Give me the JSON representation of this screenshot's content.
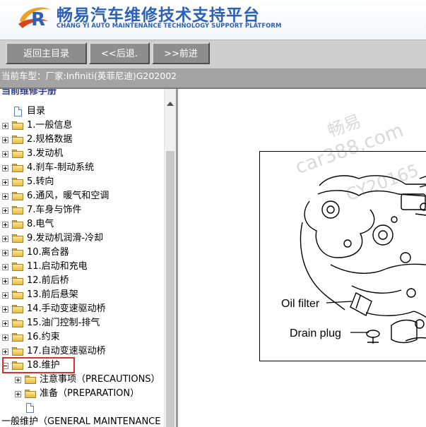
{
  "brand": {
    "title": "畅易汽车维修技术支持平台",
    "subtitle": "CHANG YI AUTO MAINTENANCE TECHNOLOGY SUPPORT PLATFORM",
    "logo_letter": "R"
  },
  "toolbar": {
    "home_label": "返回主目录",
    "back_label": "<<后退.",
    "forward_label": ">>前进"
  },
  "vehicle": {
    "text": "当前车型：厂家:Infiniti(英菲尼迪)G202002"
  },
  "tree": {
    "top_label": "当前维修手册",
    "root_doc_label": "目录",
    "folders": [
      {
        "label": "1.一般信息"
      },
      {
        "label": "2.规格数据"
      },
      {
        "label": "3.发动机"
      },
      {
        "label": "4.刹车-制动系统"
      },
      {
        "label": "5.转向"
      },
      {
        "label": "6.通风，暖气和空调"
      },
      {
        "label": "7.车身与饰件"
      },
      {
        "label": "8.电气"
      },
      {
        "label": "9.发动机润滑-冷却"
      },
      {
        "label": "10.离合器"
      },
      {
        "label": "11.启动和充电"
      },
      {
        "label": "12.前后桥"
      },
      {
        "label": "13.前后悬架"
      },
      {
        "label": "14.手动变速驱动桥"
      },
      {
        "label": "15.油门控制-排气"
      },
      {
        "label": "16.约束"
      },
      {
        "label": "17.自动变速驱动桥"
      },
      {
        "label": "18.维护"
      }
    ],
    "children": [
      {
        "label": "注意事项（PRECAUTIONS）"
      },
      {
        "label": "准备（PREPARATION）"
      }
    ],
    "bottom_label": "一般维护（GENERAL MAINTENANCE"
  },
  "diagram": {
    "oil_filter": "Oil filter",
    "drain_plug": "Drain plug"
  },
  "watermark": {
    "line1": "畅易",
    "line2": "car388.com",
    "line3": "CY20165"
  },
  "colors": {
    "brand_blue": "#2b61b8",
    "toolbar_button": "#8e8e8e",
    "vehicle_bar": "#a3a3a3",
    "highlight": "#d9302b",
    "folder_yellow": "#e6b93b"
  }
}
